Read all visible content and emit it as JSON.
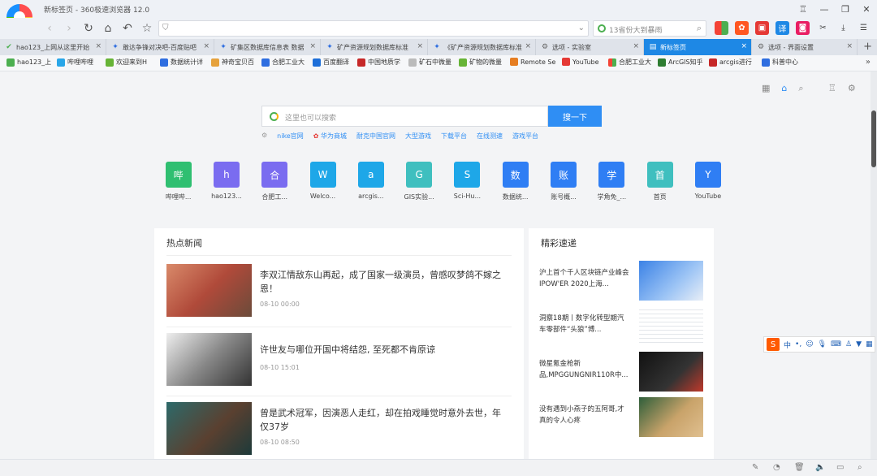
{
  "window": {
    "title": "新标签页 - 360极速浏览器 12.0"
  },
  "nav": {
    "address_value": "",
    "search_placeholder": "13省份大到暴雨"
  },
  "tabs": [
    {
      "label": "hao123_上网从这里开始"
    },
    {
      "label": "敢达争锋对决吧-百度贴吧"
    },
    {
      "label": "矿集区数据库信息表 数据"
    },
    {
      "label": "矿产资源规划数据库标准"
    },
    {
      "label": "《矿产资源规划数据库标准"
    },
    {
      "label": "选项 - 实验室"
    },
    {
      "label": "新标签页"
    },
    {
      "label": "选项 - 界面设置"
    }
  ],
  "bookmarks": [
    {
      "label": "hao123_上"
    },
    {
      "label": "哔哩哔哩"
    },
    {
      "label": "欢迎来到H"
    },
    {
      "label": "数据统计详"
    },
    {
      "label": "神奇宝贝百"
    },
    {
      "label": "合肥工业大"
    },
    {
      "label": "百度翻译"
    },
    {
      "label": "中国地质学"
    },
    {
      "label": "矿石中微量"
    },
    {
      "label": "矿物的微量"
    },
    {
      "label": "Remote Se"
    },
    {
      "label": "YouTube"
    },
    {
      "label": "合肥工业大"
    },
    {
      "label": "ArcGIS知乎"
    },
    {
      "label": "arcgis进行"
    },
    {
      "label": "科普中心"
    }
  ],
  "search": {
    "placeholder": "这里也可以搜索",
    "button": "搜一下"
  },
  "quick_links": [
    "nike官网",
    "华为商城",
    "耐克中国官网",
    "大型游戏",
    "下载平台",
    "在线测速",
    "游戏平台"
  ],
  "sites": [
    {
      "letter": "哔",
      "label": "哔哩哔...",
      "color": "#2fbf71"
    },
    {
      "letter": "h",
      "label": "hao123...",
      "color": "#7a6cf0"
    },
    {
      "letter": "合",
      "label": "合肥工...",
      "color": "#7a6cf0"
    },
    {
      "letter": "W",
      "label": "Welco...",
      "color": "#1ea7e8"
    },
    {
      "letter": "a",
      "label": "arcgis...",
      "color": "#1ea7e8"
    },
    {
      "letter": "G",
      "label": "GIS实验...",
      "color": "#3fbfbf"
    },
    {
      "letter": "S",
      "label": "Sci-Hu...",
      "color": "#1ea7e8"
    },
    {
      "letter": "数",
      "label": "数据统...",
      "color": "#2f7ef4"
    },
    {
      "letter": "账",
      "label": "账号概...",
      "color": "#2f7ef4"
    },
    {
      "letter": "学",
      "label": "学角免_...",
      "color": "#2f7ef4"
    },
    {
      "letter": "首",
      "label": "首页",
      "color": "#3fbfbf"
    },
    {
      "letter": "Y",
      "label": "YouTube",
      "color": "#2f7ef4"
    }
  ],
  "hot_news": {
    "title": "热点新闻",
    "items": [
      {
        "title": "李双江情敌东山再起，成了国家一级演员，曾感叹梦鸽不嫁之恩！",
        "date": "08-10 00:00"
      },
      {
        "title": "许世友与哪位开国中将结怨, 至死都不肯原谅",
        "date": "08-10 15:01"
      },
      {
        "title": "曾是武术冠军，因演恶人走红，却在拍戏睡觉时意外去世，年仅37岁",
        "date": "08-10 08:50"
      }
    ]
  },
  "highlights": {
    "title": "精彩速递",
    "items": [
      {
        "title": "沪上首个千人区块链产业峰会IPOW'ER 2020上海..."
      },
      {
        "title": "洞察18期丨数字化转型期汽车零部件“头狼”博..."
      },
      {
        "title": "微星氪金枪新品,MPGGUNGNIR110R中..."
      },
      {
        "title": "没有遇到小燕子的五阿哥,才真的令人心疼"
      }
    ]
  },
  "ime": {
    "label": "中"
  }
}
